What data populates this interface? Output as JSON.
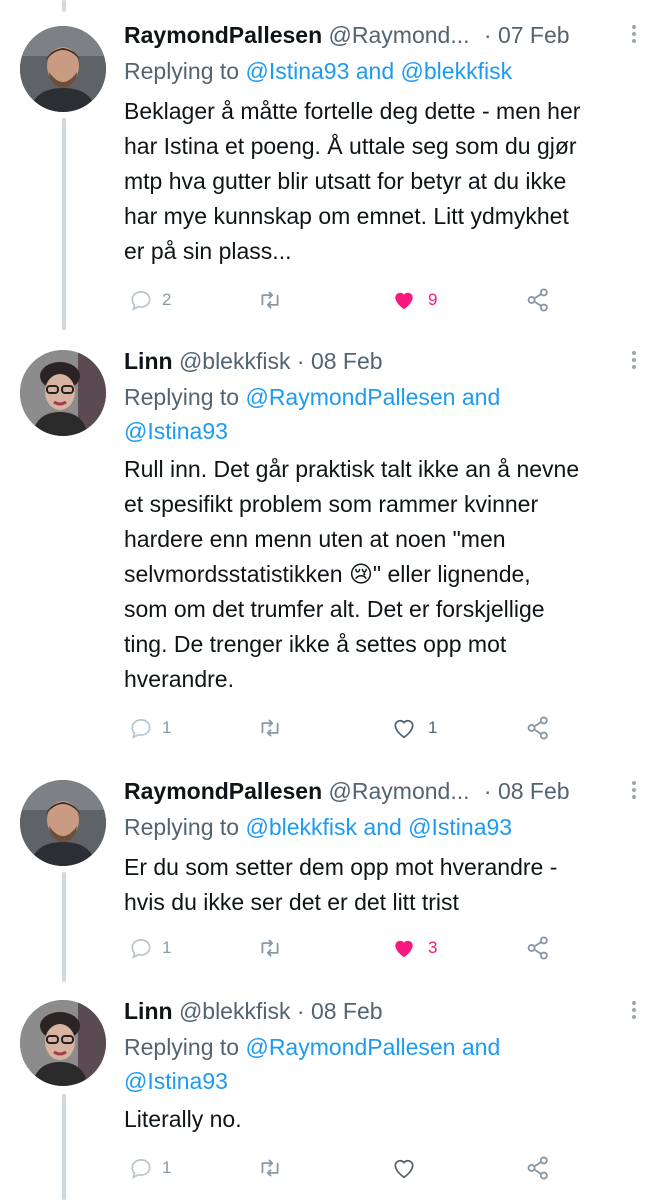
{
  "tweets": [
    {
      "name": "RaymondPallesen",
      "handle": "@Raymond...",
      "dot": "·",
      "date": "07 Feb",
      "replying_prefix": "Replying to",
      "replying_a": "@Istina93",
      "replying_join": "and",
      "replying_b": "@blekkfisk",
      "lines": [
        "Beklager å måtte fortelle deg dette - men her",
        "har Istina et poeng. Å uttale seg som du gjør",
        "mtp hva gutter blir utsatt for betyr at du ikke",
        "har mye kunnskap om emnet. Litt ydmykhet",
        "er på sin plass..."
      ],
      "replies": "2",
      "retweets": "",
      "likes": "9",
      "liked": true,
      "avatar": "man-avatar"
    },
    {
      "name": "Linn",
      "handle": "@blekkfisk",
      "dot": "·",
      "date": "08 Feb",
      "replying_prefix": "Replying to",
      "replying_a": "@RaymondPallesen",
      "replying_join": "and",
      "replying_b": "@Istina93",
      "lines": [
        "Rull inn. Det går praktisk talt ikke an å nevne",
        "et spesifikt problem som rammer kvinner",
        "hardere enn menn uten at noen \"men",
        "selvmordsstatistikken 😢\" eller lignende,",
        "som om det trumfer alt. Det er forskjellige",
        "ting. De trenger ikke å settes opp mot",
        "hverandre."
      ],
      "replies": "1",
      "retweets": "",
      "likes": "1",
      "liked": false,
      "avatar": "woman-avatar"
    },
    {
      "name": "RaymondPallesen",
      "handle": "@Raymond...",
      "dot": "·",
      "date": "08 Feb",
      "replying_prefix": "Replying to",
      "replying_a": "@blekkfisk",
      "replying_join": "and",
      "replying_b": "@Istina93",
      "lines": [
        "Er du som setter dem opp mot hverandre -",
        "hvis du ikke ser det er det litt trist"
      ],
      "replies": "1",
      "retweets": "",
      "likes": "3",
      "liked": true,
      "avatar": "man-avatar"
    },
    {
      "name": "Linn",
      "handle": "@blekkfisk",
      "dot": "·",
      "date": "08 Feb",
      "replying_prefix": "Replying to",
      "replying_a": "@RaymondPallesen",
      "replying_join": "and",
      "replying_b": "@Istina93",
      "lines": [
        "Literally no."
      ],
      "replies": "1",
      "retweets": "",
      "likes": "",
      "liked": false,
      "avatar": "woman-avatar"
    }
  ],
  "colors": {
    "link": "#1d9bf0",
    "muted": "#536471",
    "like_active": "#f91880",
    "icon": "#8b98a5"
  }
}
